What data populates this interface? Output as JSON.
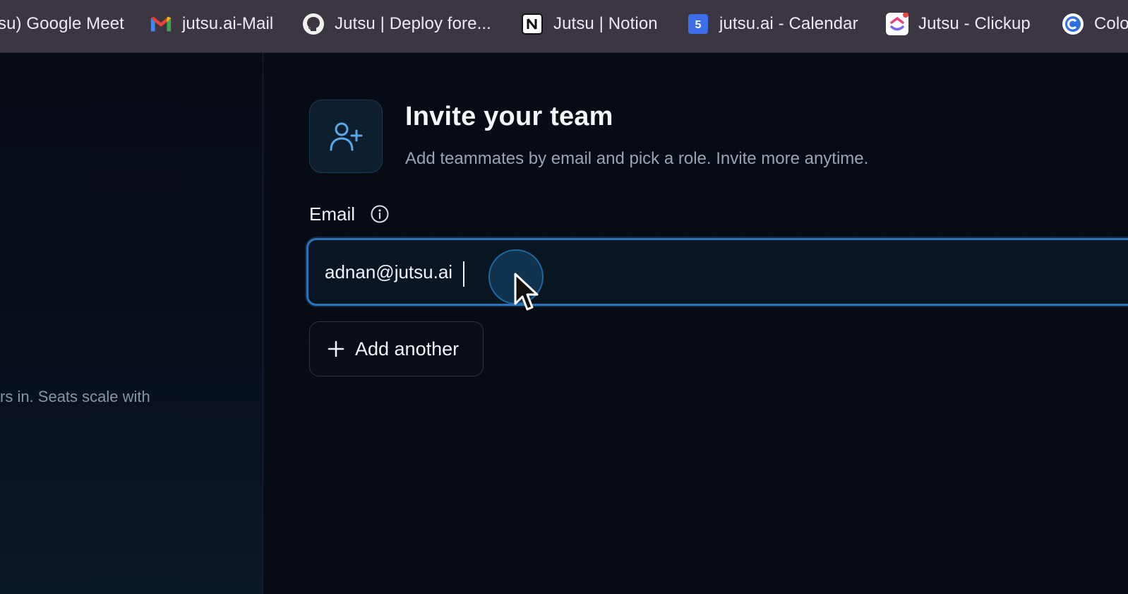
{
  "bookmarks": [
    {
      "label": "su) Google Meet",
      "icon": null
    },
    {
      "label": "jutsu.ai-Mail",
      "icon": "gmail-icon"
    },
    {
      "label": "Jutsu | Deploy fore...",
      "icon": "github-icon"
    },
    {
      "label": "Jutsu | Notion",
      "icon": "notion-icon"
    },
    {
      "label": "jutsu.ai - Calendar",
      "icon": "calendar-icon",
      "badge": "5"
    },
    {
      "label": "Jutsu - Clickup",
      "icon": "clickup-icon"
    },
    {
      "label": "Colo",
      "icon": "c-circle-icon"
    }
  ],
  "sidebar": {
    "text": "rs in. Seats scale with"
  },
  "invite": {
    "icon": "user-plus-icon",
    "title": "Invite your team",
    "subtitle": "Add teammates by email and pick a role. Invite more anytime."
  },
  "email_field": {
    "label": "Email",
    "value": "adnan@jutsu.ai",
    "info_icon": "info-icon"
  },
  "add_another": {
    "label": "Add another",
    "icon": "plus-icon"
  },
  "colors": {
    "accent": "#2e73b8",
    "bookmark_bar": "#3b3641",
    "background": "#070b13"
  }
}
